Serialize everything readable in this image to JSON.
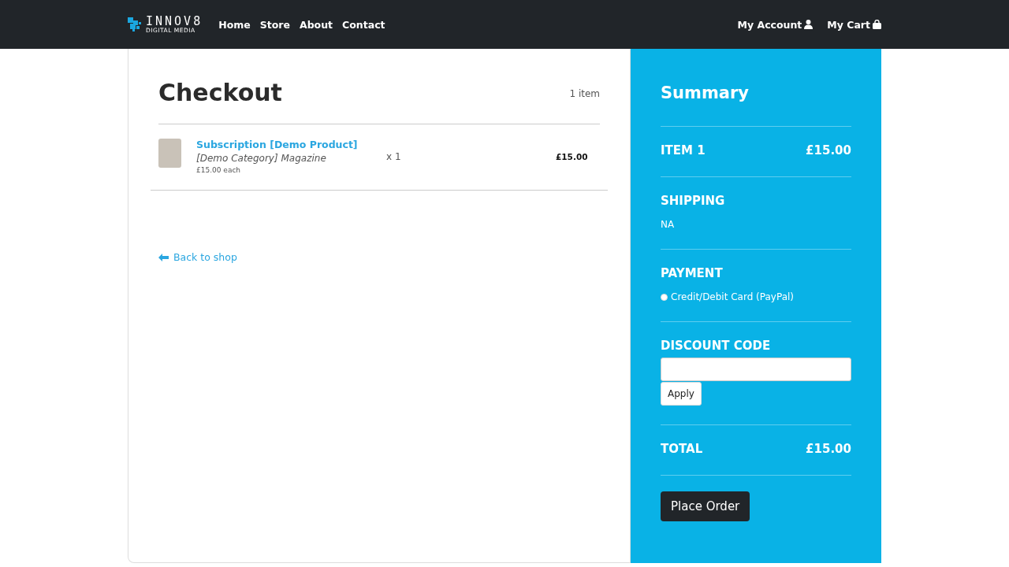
{
  "navbar": {
    "logo": {
      "top": "INNOV8",
      "bottom": "DIGITAL MEDIA"
    },
    "links": [
      "Home",
      "Store",
      "About",
      "Contact"
    ],
    "account": "My Account",
    "cart": "My Cart"
  },
  "checkout": {
    "title": "Checkout",
    "item_count": "1 item",
    "items": [
      {
        "name": "Subscription [Demo Product]",
        "category": "[Demo Category] Magazine",
        "unit_price": "£15.00 each",
        "quantity": "x 1",
        "price": "£15.00"
      }
    ],
    "back_link": "Back to shop"
  },
  "summary": {
    "title": "Summary",
    "lines": [
      {
        "label": "ITEM 1",
        "value": "£15.00"
      }
    ],
    "shipping": {
      "label": "SHIPPING",
      "value": "NA"
    },
    "payment": {
      "label": "PAYMENT",
      "options": [
        {
          "label": "Credit/Debit Card (PayPal)",
          "selected": false
        }
      ]
    },
    "discount": {
      "label": "DISCOUNT CODE",
      "button": "Apply"
    },
    "total": {
      "label": "TOTAL",
      "value": "£15.00"
    },
    "place_order": "Place Order"
  }
}
